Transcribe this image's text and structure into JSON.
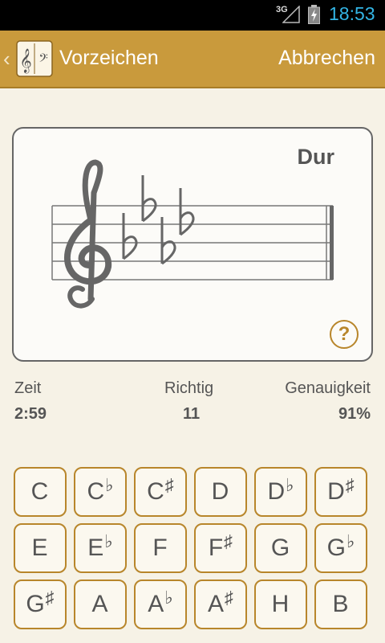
{
  "status_bar": {
    "network": "3G",
    "time": "18:53"
  },
  "action_bar": {
    "title": "Vorzeichen",
    "cancel_label": "Abbrechen"
  },
  "card": {
    "mode": "Dur",
    "clef": "treble",
    "key_signature": [
      "Bb",
      "Eb",
      "Ab",
      "Db"
    ],
    "help_label": "?"
  },
  "stats": {
    "time": {
      "label": "Zeit",
      "value": "2:59"
    },
    "correct": {
      "label": "Richtig",
      "value": "11"
    },
    "accuracy": {
      "label": "Genauigkeit",
      "value": "91%"
    }
  },
  "keys": [
    {
      "note": "C",
      "acc": ""
    },
    {
      "note": "C",
      "acc": "♭"
    },
    {
      "note": "C",
      "acc": "♯"
    },
    {
      "note": "D",
      "acc": ""
    },
    {
      "note": "D",
      "acc": "♭"
    },
    {
      "note": "D",
      "acc": "♯"
    },
    {
      "note": "E",
      "acc": ""
    },
    {
      "note": "E",
      "acc": "♭"
    },
    {
      "note": "F",
      "acc": ""
    },
    {
      "note": "F",
      "acc": "♯"
    },
    {
      "note": "G",
      "acc": ""
    },
    {
      "note": "G",
      "acc": "♭"
    },
    {
      "note": "G",
      "acc": "♯"
    },
    {
      "note": "A",
      "acc": ""
    },
    {
      "note": "A",
      "acc": "♭"
    },
    {
      "note": "A",
      "acc": "♯"
    },
    {
      "note": "H",
      "acc": ""
    },
    {
      "note": "B",
      "acc": ""
    }
  ],
  "colors": {
    "accent": "#c99a3c",
    "key_border": "#b8862b",
    "background": "#f6f2e6"
  }
}
